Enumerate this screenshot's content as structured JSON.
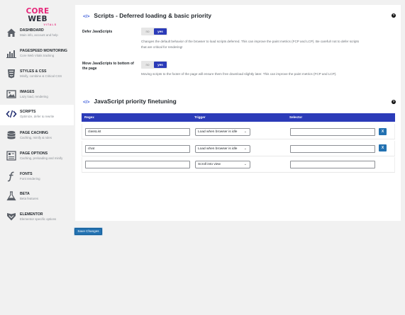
{
  "brand": {
    "logo_core": "CORE",
    "logo_web": " WEB",
    "logo_sub": "VITALS",
    "accent": "#e6277a",
    "primary": "#2b3bb8"
  },
  "sidebar": {
    "items": [
      {
        "title": "DASHBOARD",
        "sub": "Main info, account and help",
        "icon": "home-icon"
      },
      {
        "title": "PAGESPEED MONITORING",
        "sub": "Core Web Vitals tracking",
        "icon": "bar-chart-icon"
      },
      {
        "title": "STYLES & CSS",
        "sub": "Minify, combine & Critical CSS",
        "icon": "css3-icon"
      },
      {
        "title": "IMAGES",
        "sub": "Lazy load, rendering",
        "icon": "image-icon"
      },
      {
        "title": "SCRIPTS",
        "sub": "Optimize, defer & rewrite",
        "icon": "code-icon"
      },
      {
        "title": "PAGE CACHING",
        "sub": "Caching, minify & rules",
        "icon": "database-icon"
      },
      {
        "title": "PAGE OPTIONS",
        "sub": "Caching, preloading and minify",
        "icon": "page-options-icon"
      },
      {
        "title": "FONTS",
        "sub": "Font rendering",
        "icon": "font-icon"
      },
      {
        "title": "BETA",
        "sub": "Beta features",
        "icon": "flask-icon"
      },
      {
        "title": "ELEMENTOR",
        "sub": "Elementor specific options",
        "icon": "elementor-icon"
      }
    ]
  },
  "section1": {
    "title": "Scripts - Deferred loading & basic priority",
    "help": "?",
    "options": [
      {
        "label": "Defer JavaScripts",
        "no": "no",
        "yes": "yes",
        "desc1": "Changes the default behavior of the browser to load scripts deferred. This can improve the paint metrics (FCP and LCP). Be careful! not to defer scripts",
        "desc2": "that are critical for rendering!"
      },
      {
        "label1": "Move JavaScripts to bottom of",
        "label2": "the page",
        "no": "no",
        "yes": "yes",
        "desc1": "Moving scripts to the footer of the page will ensure them free download slightly later. This can improve the paint metrics (FCP and LCP)."
      }
    ]
  },
  "section2": {
    "title": "JavaScript priority finetuning",
    "help": "?",
    "columns": [
      "Regex",
      "Trigger",
      "Selector"
    ],
    "rows": [
      {
        "regex": "classList",
        "trigger": "Load when browser is idle",
        "selector": "",
        "remove": "X"
      },
      {
        "regex": "chat",
        "trigger": "Load when browser is idle",
        "selector": "",
        "remove": "X"
      },
      {
        "regex": "",
        "trigger": "Scroll into view",
        "selector": ""
      }
    ]
  },
  "footer": {
    "save_label": "Save Changes"
  }
}
